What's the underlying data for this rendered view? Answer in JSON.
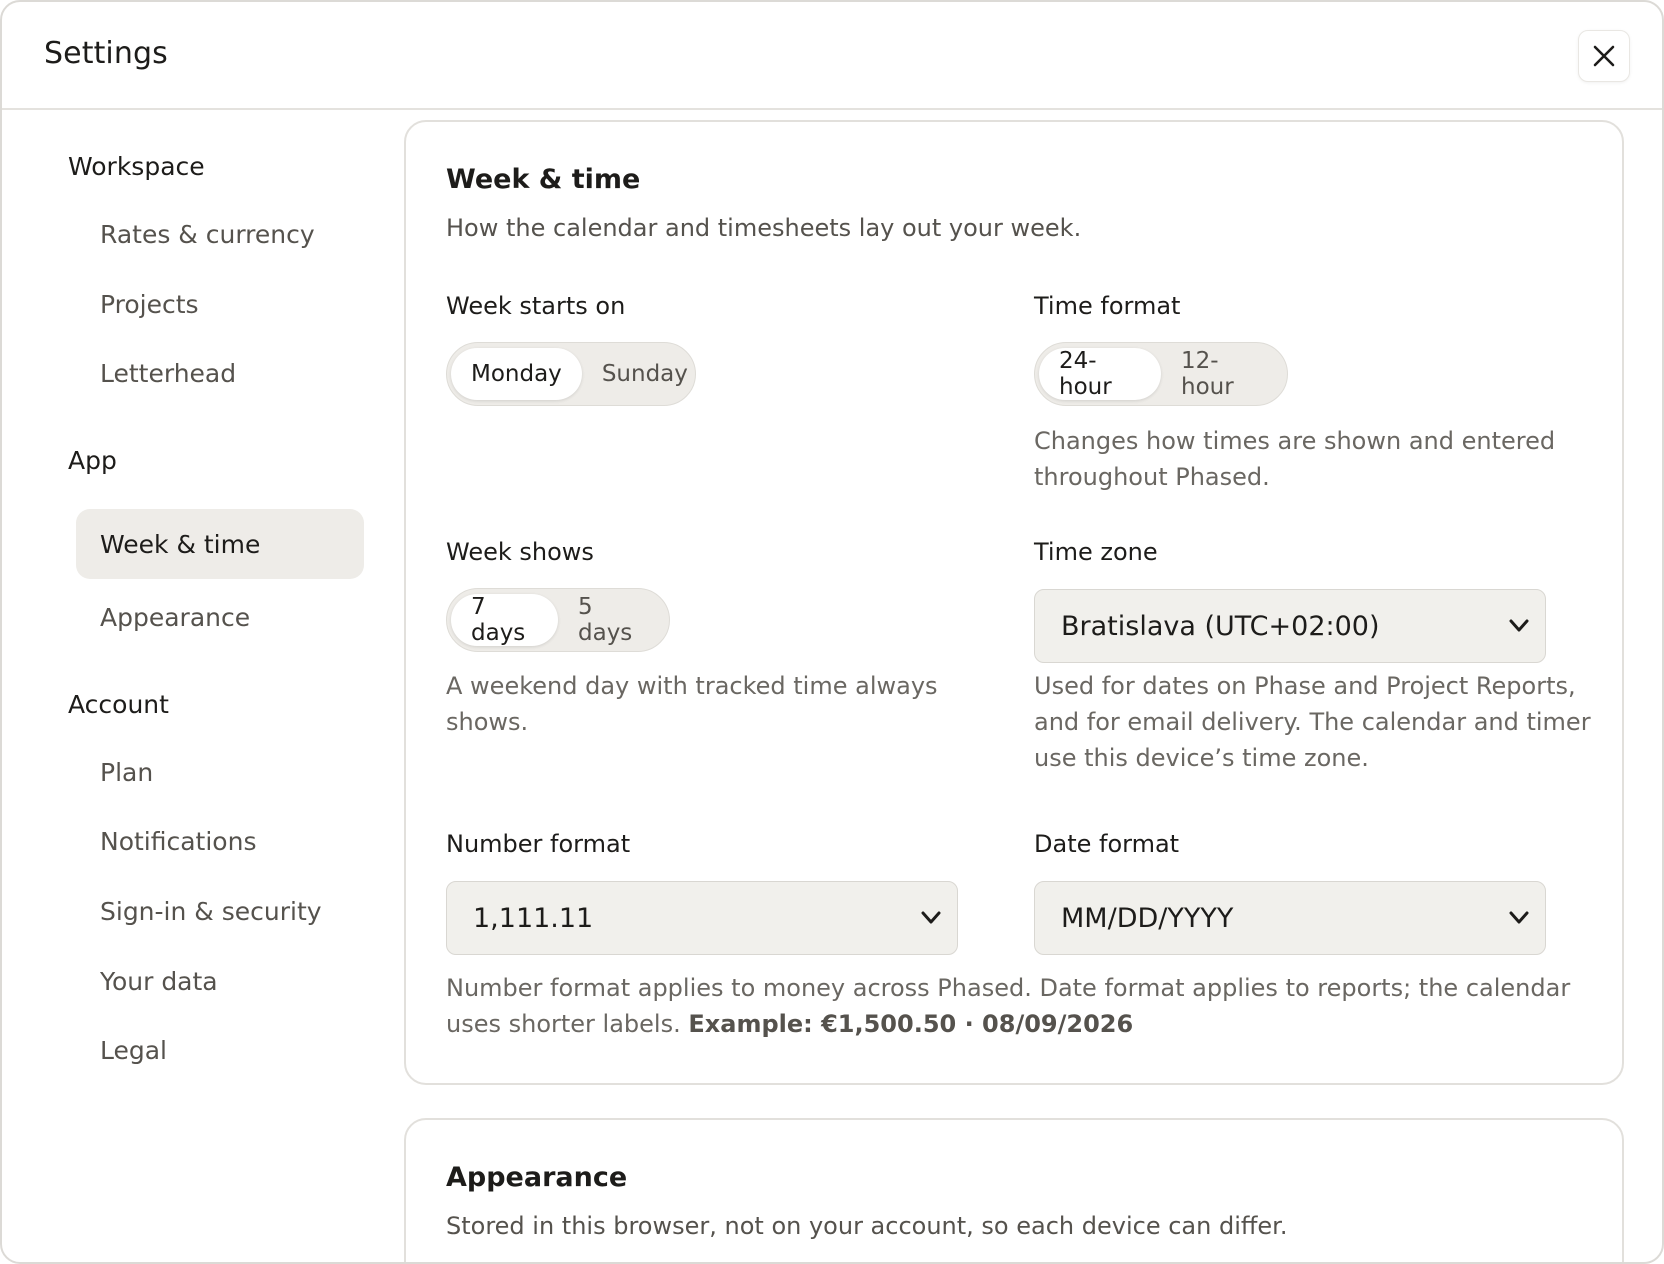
{
  "header": {
    "title": "Settings"
  },
  "sidebar": {
    "groups": [
      {
        "label": "Workspace",
        "items": [
          "Rates & currency",
          "Projects",
          "Letterhead"
        ]
      },
      {
        "label": "App",
        "items": [
          "Week & time",
          "Appearance"
        ]
      },
      {
        "label": "Account",
        "items": [
          "Plan",
          "Notifications",
          "Sign-in & security",
          "Your data",
          "Legal"
        ]
      }
    ],
    "active_item": "Week & time"
  },
  "week_time": {
    "title": "Week & time",
    "subtitle": "How the calendar and timesheets lay out your week.",
    "week_starts": {
      "label": "Week starts on",
      "options": [
        "Monday",
        "Sunday"
      ],
      "selected": "Monday"
    },
    "time_format": {
      "label": "Time format",
      "options": [
        "24-hour",
        "12-hour"
      ],
      "selected": "24-hour",
      "help_line1": "Changes how times are shown and entered",
      "help_line2": "throughout Phased."
    },
    "week_shows": {
      "label": "Week shows",
      "options": [
        "7 days",
        "5 days"
      ],
      "selected": "7 days",
      "help_line1": "A weekend day with tracked time always",
      "help_line2": "shows."
    },
    "time_zone": {
      "label": "Time zone",
      "value": "Bratislava (UTC+02:00)",
      "help_line1": "Used for dates on Phase and Project Reports,",
      "help_line2": "and for email delivery. The calendar and timer",
      "help_line3": "use this device’s time zone."
    },
    "number_format": {
      "label": "Number format",
      "value": "1,111.11"
    },
    "date_format": {
      "label": "Date format",
      "value": "MM/DD/YYYY"
    },
    "format_help_line1": "Number format applies to money across Phased. Date format applies to reports; the calendar",
    "format_help_line2": "uses shorter labels.",
    "example": "Example: €1,500.50 · 08/09/2026"
  },
  "appearance": {
    "title": "Appearance",
    "subtitle": "Stored in this browser, not on your account, so each device can differ."
  },
  "colors": {
    "accent_bg": "#eeece8",
    "text": "#1d1c1a",
    "muted": "#55524d"
  },
  "icons": {
    "close": "close-icon",
    "select_arrow": "chevron-down-icon"
  }
}
